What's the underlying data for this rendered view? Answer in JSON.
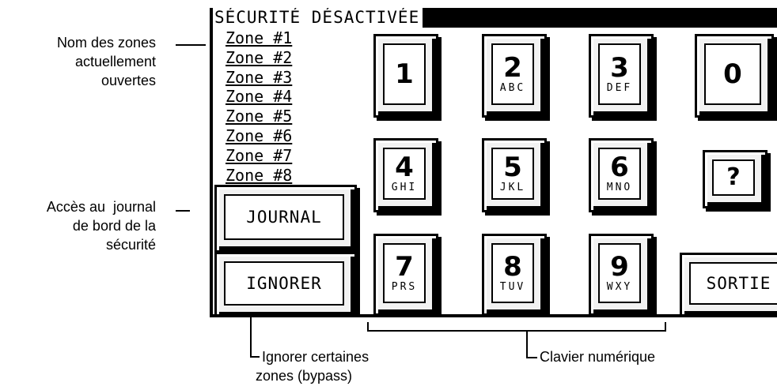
{
  "screen": {
    "status": "SÉCURITÉ DÉSACTIVÉE",
    "zones": [
      "Zone #1",
      "Zone #2",
      "Zone #3",
      "Zone #4",
      "Zone #5",
      "Zone #6",
      "Zone #7",
      "Zone #8"
    ],
    "keys": {
      "k1": {
        "digit": "1",
        "letters": ""
      },
      "k2": {
        "digit": "2",
        "letters": "ABC"
      },
      "k3": {
        "digit": "3",
        "letters": "DEF"
      },
      "k0": {
        "digit": "0",
        "letters": ""
      },
      "k4": {
        "digit": "4",
        "letters": "GHI"
      },
      "k5": {
        "digit": "5",
        "letters": "JKL"
      },
      "k6": {
        "digit": "6",
        "letters": "MNO"
      },
      "help": {
        "digit": "?"
      },
      "k7": {
        "digit": "7",
        "letters": "PRS"
      },
      "k8": {
        "digit": "8",
        "letters": "TUV"
      },
      "k9": {
        "digit": "9",
        "letters": "WXY"
      }
    },
    "journal_label": "JOURNAL",
    "ignore_label": "IGNORER",
    "exit_label": "SORTIE"
  },
  "annotations": {
    "zones_callout": [
      "Nom des zones",
      "actuellement",
      "ouvertes"
    ],
    "journal_callout": [
      "Accès au  journal",
      "de bord de la",
      "sécurité"
    ],
    "ignore_callout": [
      "Ignorer certaines",
      "zones (bypass)"
    ],
    "keypad_callout": "Clavier numérique"
  }
}
